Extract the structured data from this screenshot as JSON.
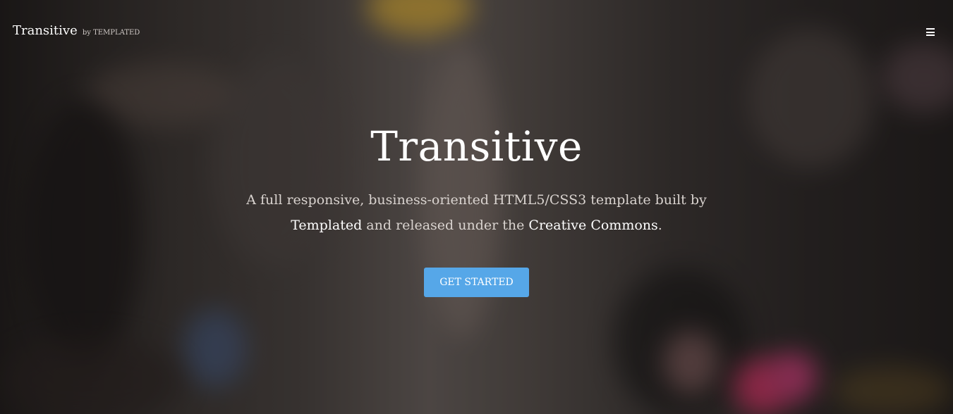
{
  "header": {
    "logo_name": "Transitive",
    "logo_by": "by TEMPLATED",
    "menu_icon": "hamburger-menu-icon"
  },
  "hero": {
    "title": "Transitive",
    "tagline_part1": "A full responsive, business-oriented HTML5/CSS3 template built by ",
    "link_templated": "Templated",
    "tagline_part2": " and released under the ",
    "link_creative_commons": "Creative Commons",
    "tagline_end": ".",
    "cta_label": "GET STARTED"
  },
  "colors": {
    "cta_background": "#56a7e8",
    "overlay": "#141211"
  }
}
